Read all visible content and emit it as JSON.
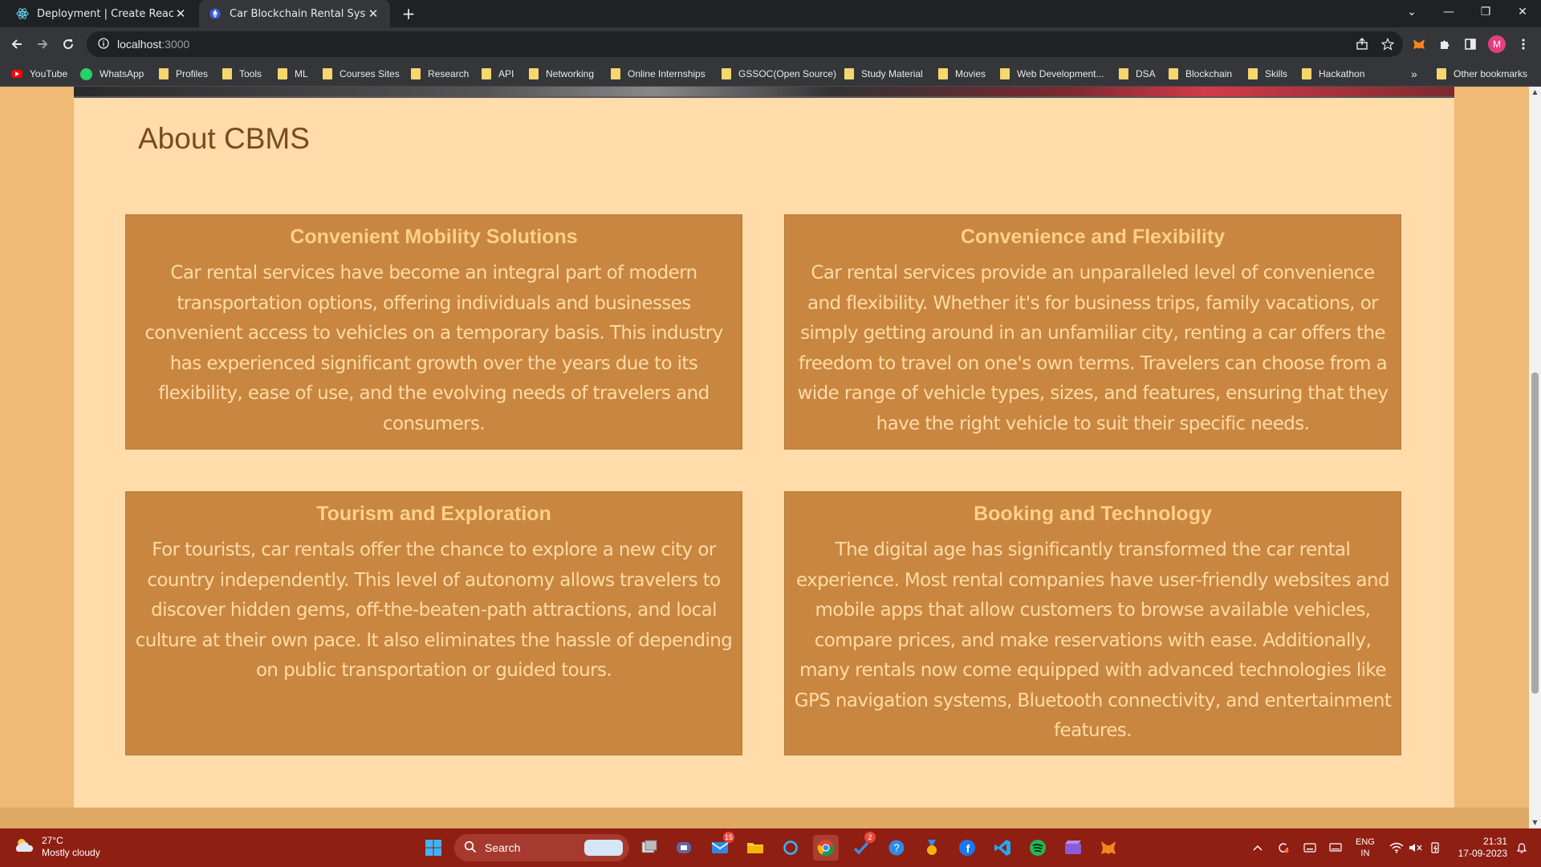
{
  "browser": {
    "tabs": [
      {
        "title": "Deployment | Create React App",
        "active": false
      },
      {
        "title": "Car Blockchain Rental System",
        "active": true
      }
    ],
    "new_tab_symbol": "+",
    "close_symbol": "✕",
    "url_host": "localhost",
    "url_port": ":3000",
    "profile_initial": "M",
    "bookmarks": [
      "YouTube",
      "WhatsApp",
      "Profiles",
      "Tools",
      "ML",
      "Courses Sites",
      "Research",
      "API",
      "Networking",
      "Online Internships",
      "GSSOC(Open Source)",
      "Study Material",
      "Movies",
      "Web Development...",
      "DSA",
      "Blockchain",
      "Skills",
      "Hackathon"
    ],
    "bookmarks_overflow": "»",
    "other_bookmarks": "Other bookmarks"
  },
  "page": {
    "about_title": "About CBMS",
    "cards": [
      {
        "title": "Convenient Mobility Solutions",
        "body": "Car rental services have become an integral part of modern transportation options, offering individuals and businesses convenient access to vehicles on a temporary basis. This industry has experienced significant growth over the years due to its flexibility, ease of use, and the evolving needs of travelers and consumers."
      },
      {
        "title": "Convenience and Flexibility",
        "body": "Car rental services provide an unparalleled level of convenience and flexibility. Whether it's for business trips, family vacations, or simply getting around in an unfamiliar city, renting a car offers the freedom to travel on one's own terms. Travelers can choose from a wide range of vehicle types, sizes, and features, ensuring that they have the right vehicle to suit their specific needs."
      },
      {
        "title": "Tourism and Exploration",
        "body": "For tourists, car rentals offer the chance to explore a new city or country independently. This level of autonomy allows travelers to discover hidden gems, off-the-beaten-path attractions, and local culture at their own pace. It also eliminates the hassle of depending on public transportation or guided tours."
      },
      {
        "title": "Booking and Technology",
        "body": "The digital age has significantly transformed the car rental experience. Most rental companies have user-friendly websites and mobile apps that allow customers to browse available vehicles, compare prices, and make reservations with ease. Additionally, many rentals now come equipped with advanced technologies like GPS navigation systems, Bluetooth connectivity, and entertainment features."
      }
    ]
  },
  "taskbar": {
    "weather_temp": "27°C",
    "weather_desc": "Mostly cloudy",
    "search_label": "Search",
    "mail_badge": "15",
    "todo_badge": "2",
    "lang_line1": "ENG",
    "lang_line2": "IN",
    "time": "21:31",
    "date": "17-09-2023"
  },
  "colors": {
    "page_bg": "#eeba75",
    "content_bg": "#ffdcaa",
    "card_bg": "#c98640",
    "card_title": "#ffd089",
    "card_text": "#ffdba6",
    "heading": "#7a4a1f",
    "taskbar": "#8f1e13"
  }
}
